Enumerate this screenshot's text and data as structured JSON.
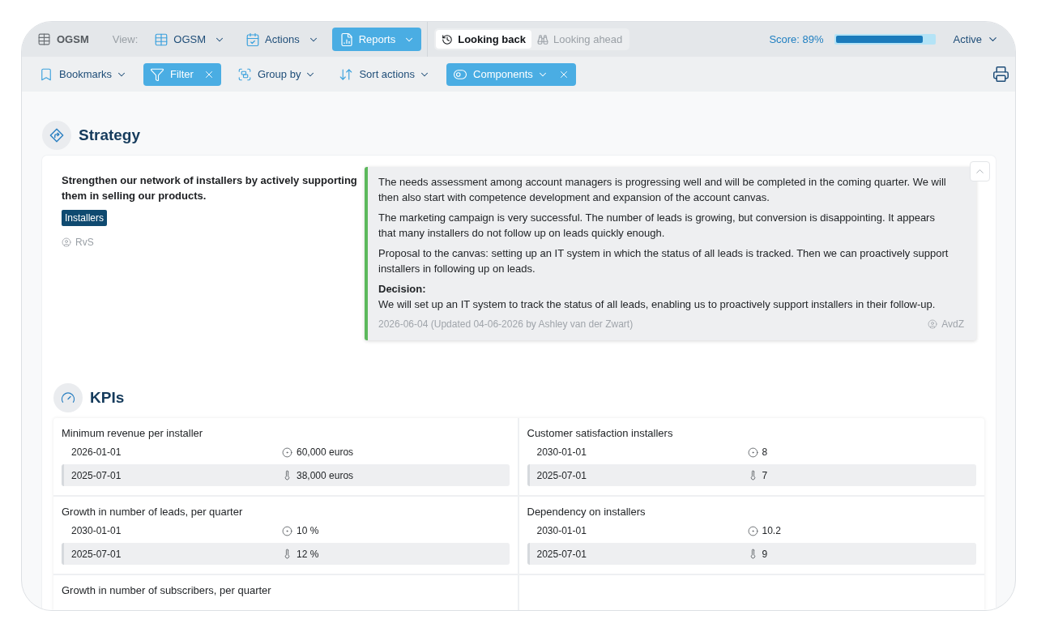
{
  "topbar": {
    "app_title": "OGSM",
    "view_label": "View:",
    "views": [
      {
        "label": "OGSM",
        "selected": false
      },
      {
        "label": "Actions",
        "selected": false
      },
      {
        "label": "Reports",
        "selected": true
      }
    ],
    "period_toggle": [
      {
        "label": "Looking back",
        "selected": true
      },
      {
        "label": "Looking ahead",
        "selected": false
      }
    ],
    "score": {
      "label": "Score: 89%",
      "level": 0.89
    },
    "status": {
      "label": "Active"
    }
  },
  "toolbar": {
    "items": [
      {
        "label": "Bookmarks",
        "active": false,
        "has_menu": true
      },
      {
        "label": "Filter",
        "active": true,
        "has_menu": false
      },
      {
        "label": "Group by",
        "active": false,
        "has_menu": true
      },
      {
        "label": "Sort actions",
        "active": false,
        "has_menu": true
      },
      {
        "label": "Components",
        "active": true,
        "has_menu": true
      }
    ]
  },
  "strategy": {
    "title": "Strategy",
    "objective": "Strengthen our network of installers by actively supporting them in selling our products.",
    "tags": [
      "Installers"
    ],
    "owner": "RvS",
    "expanded": true,
    "note": {
      "paragraphs": [
        "The needs assessment among account managers is progressing well and will be completed in the coming quarter. We will then also start with competence development and expansion of the account canvas.",
        "The marketing campaign is very successful. The number of leads is growing, but conversion is disappointing. It appears that many installers do not follow up on leads quickly enough.",
        "Proposal to the canvas: setting up an IT system in which the status of all leads is tracked. Then we can proactively support installers in following up on leads."
      ],
      "decision_label": "Decision:",
      "decision": "We will set up an IT system to track the status of all leads, enabling us to proactively support installers in their follow-up.",
      "meta": "2026-06-04 (Updated 04-06-2026 by Ashley van der Zwart)",
      "author": "AvdZ"
    }
  },
  "kpis": {
    "title": "KPIs",
    "items": [
      {
        "name": "Minimum revenue per installer",
        "target": {
          "date": "2026-01-01",
          "value": "60,000 euros"
        },
        "actual": {
          "date": "2025-07-01",
          "value": "38,000 euros"
        }
      },
      {
        "name": "Customer satisfaction installers",
        "target": {
          "date": "2030-01-01",
          "value": "8"
        },
        "actual": {
          "date": "2025-07-01",
          "value": "7"
        }
      },
      {
        "name": "Growth in number of leads, per quarter",
        "target": {
          "date": "2030-01-01",
          "value": "10 %"
        },
        "actual": {
          "date": "2025-07-01",
          "value": "12 %"
        }
      },
      {
        "name": "Dependency on installers",
        "target": {
          "date": "2030-01-01",
          "value": "10.2"
        },
        "actual": {
          "date": "2025-07-01",
          "value": "9"
        }
      },
      {
        "name": "Growth in number of subscribers, per quarter"
      }
    ]
  }
}
